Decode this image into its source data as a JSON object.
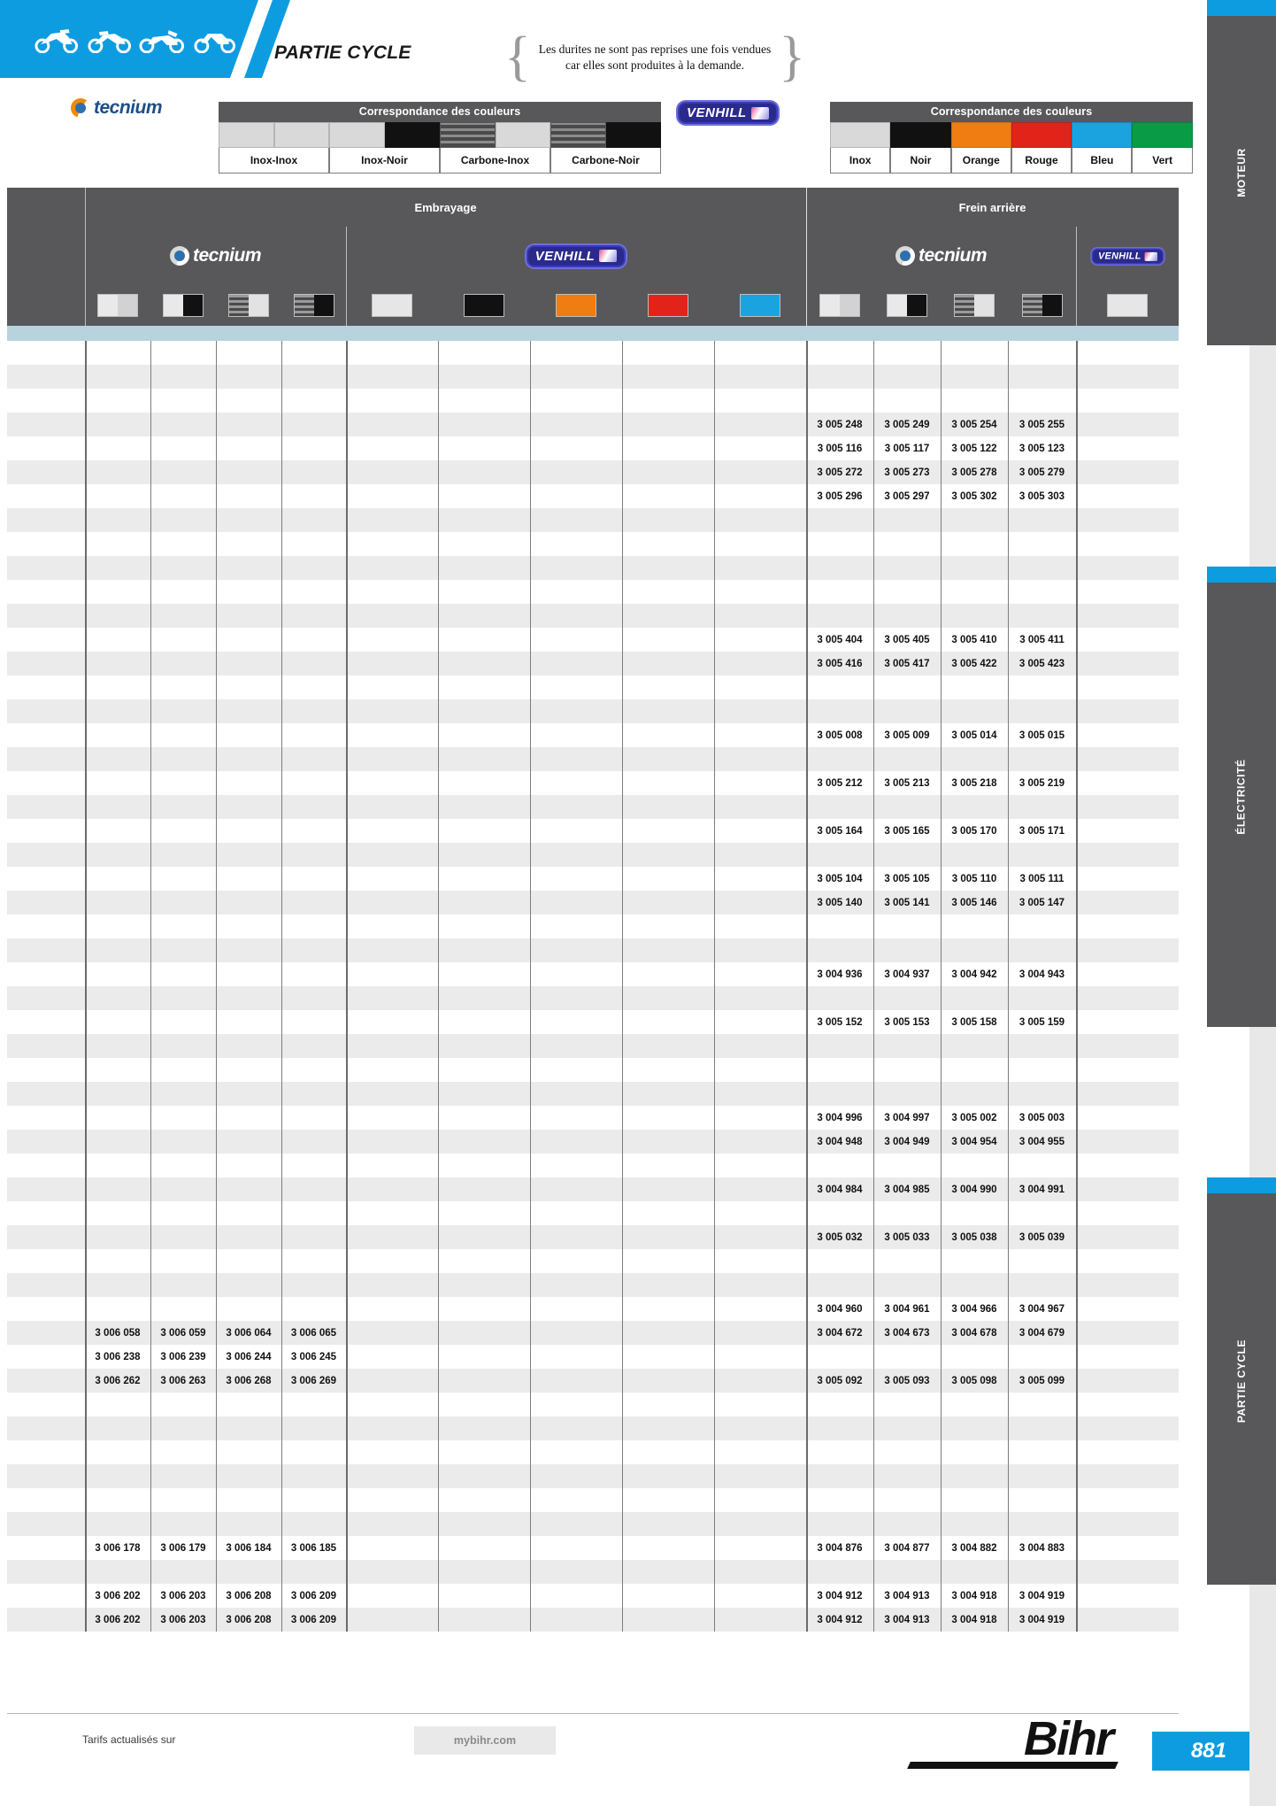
{
  "header": {
    "section_title": "PARTIE CYCLE",
    "banner_icons": [
      "motorcycle-icon",
      "dirtbike-icon",
      "scooter-icon",
      "quad-icon"
    ],
    "note": "Les durites ne sont pas reprises une fois vendues car elles sont produites à la demande."
  },
  "legends": [
    {
      "brand": "tecnium",
      "title": "Correspondance des couleurs",
      "columns": [
        {
          "label": "Inox-Inox",
          "swatches": [
            "#d9d9d9",
            "#d9d9d9"
          ]
        },
        {
          "label": "Inox-Noir",
          "swatches": [
            "#d9d9d9",
            "#111111"
          ]
        },
        {
          "label": "Carbone-Inox",
          "swatches": [
            "carbon",
            "#d9d9d9"
          ]
        },
        {
          "label": "Carbone-Noir",
          "swatches": [
            "carbon",
            "#111111"
          ]
        }
      ]
    },
    {
      "brand": "VENHILL",
      "title": "Correspondance des couleurs",
      "columns": [
        {
          "label": "Inox",
          "swatch": "#d9d9d9"
        },
        {
          "label": "Noir",
          "swatch": "#111111"
        },
        {
          "label": "Orange",
          "swatch": "#ef7d12"
        },
        {
          "label": "Rouge",
          "swatch": "#e2231a"
        },
        {
          "label": "Bleu",
          "swatch": "#1ba3e0"
        },
        {
          "label": "Vert",
          "swatch": "#0a9b46"
        }
      ]
    }
  ],
  "table": {
    "groups": [
      {
        "label": "Embrayage",
        "span": 9
      },
      {
        "label": "Frein arrière",
        "span": 5
      }
    ],
    "brands": [
      {
        "label": "tecnium",
        "span": 4
      },
      {
        "label": "VENHILL",
        "span": 5
      },
      {
        "label": "tecnium",
        "span": 4
      },
      {
        "label": "VENHILL",
        "span": 1
      }
    ],
    "swatches": [
      [
        "#d9d9d9",
        "#d9d9d9"
      ],
      [
        "#d9d9d9",
        "#111111"
      ],
      [
        "carbon",
        "#d9d9d9"
      ],
      [
        "carbon",
        "#111111"
      ],
      [
        "#d9d9d9"
      ],
      [
        "#111111"
      ],
      [
        "#ef7d12"
      ],
      [
        "#e2231a"
      ],
      [
        "#1ba3e0"
      ],
      [
        "#d9d9d9",
        "#d9d9d9"
      ],
      [
        "#d9d9d9",
        "#111111"
      ],
      [
        "carbon",
        "#d9d9d9"
      ],
      [
        "carbon",
        "#111111"
      ],
      [
        "#d9d9d9"
      ]
    ],
    "rows": [
      [
        "",
        "",
        "",
        "",
        "",
        "",
        "",
        "",
        "",
        "",
        "",
        "",
        "",
        ""
      ],
      [
        "",
        "",
        "",
        "",
        "",
        "",
        "",
        "",
        "",
        "",
        "",
        "",
        "",
        ""
      ],
      [
        "",
        "",
        "",
        "",
        "",
        "",
        "",
        "",
        "",
        "",
        "",
        "",
        "",
        ""
      ],
      [
        "",
        "",
        "",
        "",
        "",
        "",
        "",
        "",
        "",
        "3 005 248",
        "3 005 249",
        "3 005 254",
        "3 005 255",
        ""
      ],
      [
        "",
        "",
        "",
        "",
        "",
        "",
        "",
        "",
        "",
        "3 005 116",
        "3 005 117",
        "3 005 122",
        "3 005 123",
        ""
      ],
      [
        "",
        "",
        "",
        "",
        "",
        "",
        "",
        "",
        "",
        "3 005 272",
        "3 005 273",
        "3 005 278",
        "3 005 279",
        ""
      ],
      [
        "",
        "",
        "",
        "",
        "",
        "",
        "",
        "",
        "",
        "3 005 296",
        "3 005 297",
        "3 005 302",
        "3 005 303",
        ""
      ],
      [
        "",
        "",
        "",
        "",
        "",
        "",
        "",
        "",
        "",
        "",
        "",
        "",
        "",
        ""
      ],
      [
        "",
        "",
        "",
        "",
        "",
        "",
        "",
        "",
        "",
        "",
        "",
        "",
        "",
        ""
      ],
      [
        "",
        "",
        "",
        "",
        "",
        "",
        "",
        "",
        "",
        "",
        "",
        "",
        "",
        ""
      ],
      [
        "",
        "",
        "",
        "",
        "",
        "",
        "",
        "",
        "",
        "",
        "",
        "",
        "",
        ""
      ],
      [
        "",
        "",
        "",
        "",
        "",
        "",
        "",
        "",
        "",
        "",
        "",
        "",
        "",
        ""
      ],
      [
        "",
        "",
        "",
        "",
        "",
        "",
        "",
        "",
        "",
        "3 005 404",
        "3 005 405",
        "3 005 410",
        "3 005 411",
        ""
      ],
      [
        "",
        "",
        "",
        "",
        "",
        "",
        "",
        "",
        "",
        "3 005 416",
        "3 005 417",
        "3 005 422",
        "3 005 423",
        ""
      ],
      [
        "",
        "",
        "",
        "",
        "",
        "",
        "",
        "",
        "",
        "",
        "",
        "",
        "",
        ""
      ],
      [
        "",
        "",
        "",
        "",
        "",
        "",
        "",
        "",
        "",
        "",
        "",
        "",
        "",
        ""
      ],
      [
        "",
        "",
        "",
        "",
        "",
        "",
        "",
        "",
        "",
        "3 005 008",
        "3 005 009",
        "3 005 014",
        "3 005 015",
        ""
      ],
      [
        "",
        "",
        "",
        "",
        "",
        "",
        "",
        "",
        "",
        "",
        "",
        "",
        "",
        ""
      ],
      [
        "",
        "",
        "",
        "",
        "",
        "",
        "",
        "",
        "",
        "3 005 212",
        "3 005 213",
        "3 005 218",
        "3 005 219",
        ""
      ],
      [
        "",
        "",
        "",
        "",
        "",
        "",
        "",
        "",
        "",
        "",
        "",
        "",
        "",
        ""
      ],
      [
        "",
        "",
        "",
        "",
        "",
        "",
        "",
        "",
        "",
        "3 005 164",
        "3 005 165",
        "3 005 170",
        "3 005 171",
        ""
      ],
      [
        "",
        "",
        "",
        "",
        "",
        "",
        "",
        "",
        "",
        "",
        "",
        "",
        "",
        ""
      ],
      [
        "",
        "",
        "",
        "",
        "",
        "",
        "",
        "",
        "",
        "3 005 104",
        "3 005 105",
        "3 005 110",
        "3 005 111",
        ""
      ],
      [
        "",
        "",
        "",
        "",
        "",
        "",
        "",
        "",
        "",
        "3 005 140",
        "3 005 141",
        "3 005 146",
        "3 005 147",
        ""
      ],
      [
        "",
        "",
        "",
        "",
        "",
        "",
        "",
        "",
        "",
        "",
        "",
        "",
        "",
        ""
      ],
      [
        "",
        "",
        "",
        "",
        "",
        "",
        "",
        "",
        "",
        "",
        "",
        "",
        "",
        ""
      ],
      [
        "",
        "",
        "",
        "",
        "",
        "",
        "",
        "",
        "",
        "3 004 936",
        "3 004 937",
        "3 004 942",
        "3 004 943",
        ""
      ],
      [
        "",
        "",
        "",
        "",
        "",
        "",
        "",
        "",
        "",
        "",
        "",
        "",
        "",
        ""
      ],
      [
        "",
        "",
        "",
        "",
        "",
        "",
        "",
        "",
        "",
        "3 005 152",
        "3 005 153",
        "3 005 158",
        "3 005 159",
        ""
      ],
      [
        "",
        "",
        "",
        "",
        "",
        "",
        "",
        "",
        "",
        "",
        "",
        "",
        "",
        ""
      ],
      [
        "",
        "",
        "",
        "",
        "",
        "",
        "",
        "",
        "",
        "",
        "",
        "",
        "",
        ""
      ],
      [
        "",
        "",
        "",
        "",
        "",
        "",
        "",
        "",
        "",
        "",
        "",
        "",
        "",
        ""
      ],
      [
        "",
        "",
        "",
        "",
        "",
        "",
        "",
        "",
        "",
        "3 004 996",
        "3 004 997",
        "3 005 002",
        "3 005 003",
        ""
      ],
      [
        "",
        "",
        "",
        "",
        "",
        "",
        "",
        "",
        "",
        "3 004 948",
        "3 004 949",
        "3 004 954",
        "3 004 955",
        ""
      ],
      [
        "",
        "",
        "",
        "",
        "",
        "",
        "",
        "",
        "",
        "",
        "",
        "",
        "",
        ""
      ],
      [
        "",
        "",
        "",
        "",
        "",
        "",
        "",
        "",
        "",
        "3 004 984",
        "3 004 985",
        "3 004 990",
        "3 004 991",
        ""
      ],
      [
        "",
        "",
        "",
        "",
        "",
        "",
        "",
        "",
        "",
        "",
        "",
        "",
        "",
        ""
      ],
      [
        "",
        "",
        "",
        "",
        "",
        "",
        "",
        "",
        "",
        "3 005 032",
        "3 005 033",
        "3 005 038",
        "3 005 039",
        ""
      ],
      [
        "",
        "",
        "",
        "",
        "",
        "",
        "",
        "",
        "",
        "",
        "",
        "",
        "",
        ""
      ],
      [
        "",
        "",
        "",
        "",
        "",
        "",
        "",
        "",
        "",
        "",
        "",
        "",
        "",
        ""
      ],
      [
        "",
        "",
        "",
        "",
        "",
        "",
        "",
        "",
        "",
        "3 004 960",
        "3 004 961",
        "3 004 966",
        "3 004 967",
        ""
      ],
      [
        "3 006 058",
        "3 006 059",
        "3 006 064",
        "3 006 065",
        "",
        "",
        "",
        "",
        "",
        "3 004 672",
        "3 004 673",
        "3 004 678",
        "3 004 679",
        ""
      ],
      [
        "3 006 238",
        "3 006 239",
        "3 006 244",
        "3 006 245",
        "",
        "",
        "",
        "",
        "",
        "",
        "",
        "",
        "",
        ""
      ],
      [
        "3 006 262",
        "3 006 263",
        "3 006 268",
        "3 006 269",
        "",
        "",
        "",
        "",
        "",
        "3 005 092",
        "3 005 093",
        "3 005 098",
        "3 005 099",
        ""
      ],
      [
        "",
        "",
        "",
        "",
        "",
        "",
        "",
        "",
        "",
        "",
        "",
        "",
        "",
        ""
      ],
      [
        "",
        "",
        "",
        "",
        "",
        "",
        "",
        "",
        "",
        "",
        "",
        "",
        "",
        ""
      ],
      [
        "",
        "",
        "",
        "",
        "",
        "",
        "",
        "",
        "",
        "",
        "",
        "",
        "",
        ""
      ],
      [
        "",
        "",
        "",
        "",
        "",
        "",
        "",
        "",
        "",
        "",
        "",
        "",
        "",
        ""
      ],
      [
        "",
        "",
        "",
        "",
        "",
        "",
        "",
        "",
        "",
        "",
        "",
        "",
        "",
        ""
      ],
      [
        "",
        "",
        "",
        "",
        "",
        "",
        "",
        "",
        "",
        "",
        "",
        "",
        "",
        ""
      ],
      [
        "3 006 178",
        "3 006 179",
        "3 006 184",
        "3 006 185",
        "",
        "",
        "",
        "",
        "",
        "3 004 876",
        "3 004 877",
        "3 004 882",
        "3 004 883",
        ""
      ],
      [
        "",
        "",
        "",
        "",
        "",
        "",
        "",
        "",
        "",
        "",
        "",
        "",
        "",
        ""
      ],
      [
        "3 006 202",
        "3 006 203",
        "3 006 208",
        "3 006 209",
        "",
        "",
        "",
        "",
        "",
        "3 004 912",
        "3 004 913",
        "3 004 918",
        "3 004 919",
        ""
      ],
      [
        "3 006 202",
        "3 006 203",
        "3 006 208",
        "3 006 209",
        "",
        "",
        "",
        "",
        "",
        "3 004 912",
        "3 004 913",
        "3 004 918",
        "3 004 919",
        ""
      ]
    ]
  },
  "side_tabs": [
    {
      "label": "MOTEUR"
    },
    {
      "label": "ÉLECTRICITÉ"
    },
    {
      "label": "PARTIE CYCLE"
    }
  ],
  "footer": {
    "tarifs": "Tarifs actualisés sur",
    "mybihr": "mybihr.com",
    "brand": "Bihr",
    "page": "881"
  },
  "colors": {
    "accent": "#0e9ce0",
    "header_gray": "#58585a",
    "row_alt": "#ebebeb",
    "blue_band": "#b9d3de"
  }
}
